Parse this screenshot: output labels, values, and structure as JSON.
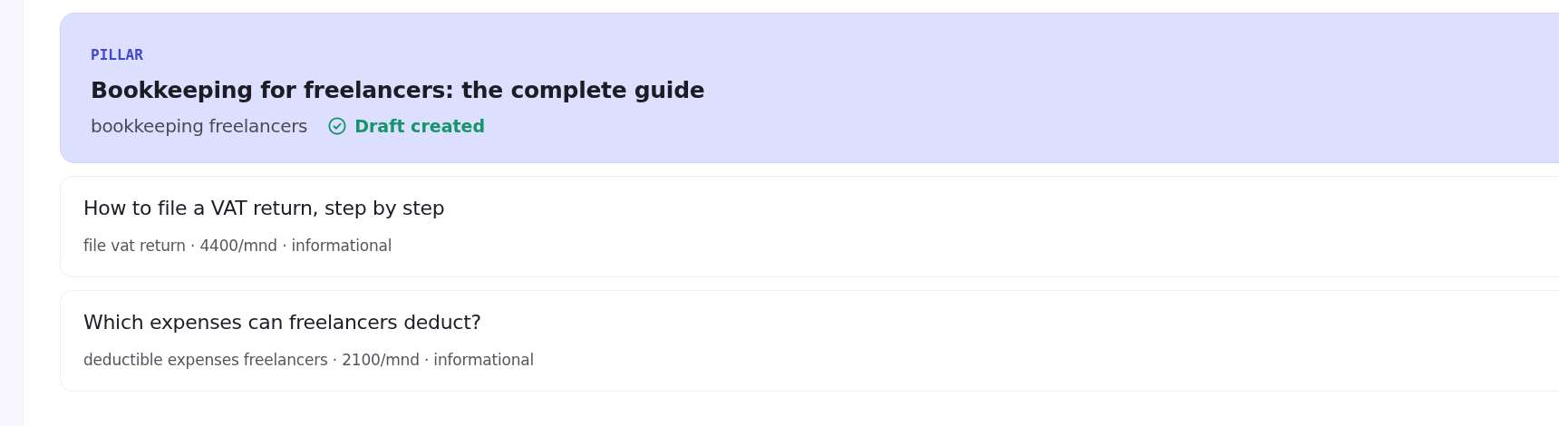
{
  "pillar": {
    "tag": "PILLAR",
    "title": "Bookkeeping for freelancers: the complete guide",
    "keyword": "bookkeeping freelancers",
    "status": {
      "kind": "done",
      "label": "Draft created"
    }
  },
  "articles": [
    {
      "title": "How to file a VAT return, step by step",
      "meta": "file vat return · 4400/mnd · informational"
    },
    {
      "title": "Which expenses can freelancers deduct?",
      "meta": "deductible expenses freelancers · 2100/mnd · informational"
    }
  ]
}
